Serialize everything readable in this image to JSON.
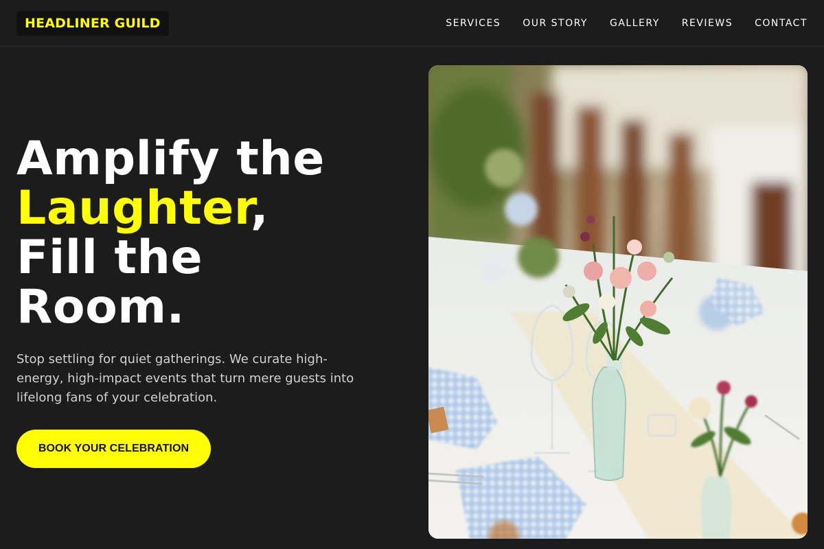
{
  "brand": {
    "name": "HEADLINER GUILD"
  },
  "nav": {
    "items": [
      "SERVICES",
      "OUR STORY",
      "GALLERY",
      "REVIEWS",
      "CONTACT"
    ]
  },
  "hero": {
    "headline_line1": "Amplify the",
    "headline_accent": "Laughter",
    "headline_comma": ",",
    "headline_line3": "Fill the",
    "headline_line4": "Room.",
    "subtext": "Stop settling for quiet gatherings. We curate high-energy, high-impact events that turn mere guests into lifelong fans of your celebration.",
    "cta_label": "BOOK YOUR CELEBRATION",
    "image_alt": "Wedding reception table with flower arrangements and glassware"
  },
  "colors": {
    "accent": "#ffff00",
    "background": "#1c1c1c",
    "text": "#ffffff"
  }
}
